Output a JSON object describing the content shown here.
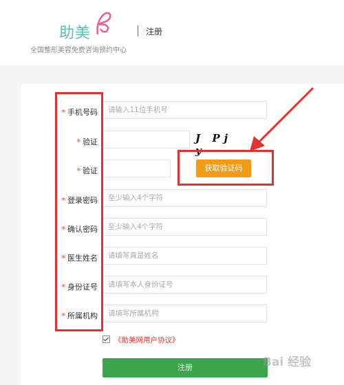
{
  "header": {
    "logo_text": "助美",
    "tagline": "全国整形美容免费咨询预约中心",
    "title": "注册",
    "logo_color": "#5bbfb5",
    "logo_mark_color": "#e8608c"
  },
  "form": {
    "fields": [
      {
        "label": "手机号码",
        "placeholder": "请输入11位手机号"
      },
      {
        "label": "验证",
        "placeholder": ""
      },
      {
        "label": "验证",
        "placeholder": ""
      },
      {
        "label": "登录密码",
        "placeholder": "至少输入4个字符"
      },
      {
        "label": "确认密码",
        "placeholder": "至少输入4个字符"
      },
      {
        "label": "医生姓名",
        "placeholder": "请填写真是姓名"
      },
      {
        "label": "身份证号",
        "placeholder": "请填写本人身份证号"
      },
      {
        "label": "所属机构",
        "placeholder": "请填写所属机构"
      }
    ],
    "required_mark": "*",
    "captcha_text": "J Pj y",
    "get_code_label": "获取验证码",
    "agreement_text": "《助美网用户协议》",
    "submit_label": "注册"
  },
  "watermark": "Bai 经验",
  "colors": {
    "accent_orange": "#f39b16",
    "submit_green": "#3aa54a",
    "annotation_red": "#e0322e",
    "required_red": "#e33"
  }
}
